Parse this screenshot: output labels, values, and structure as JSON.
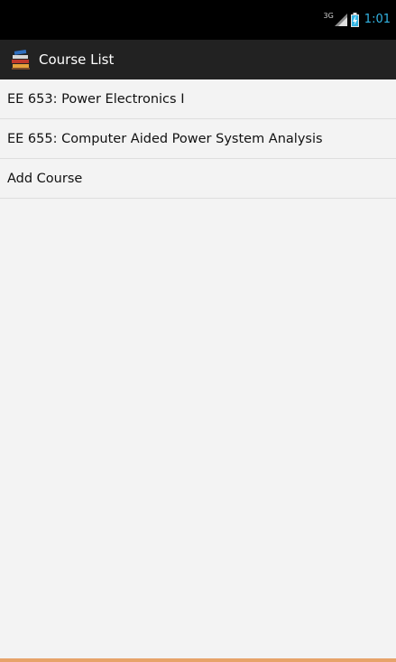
{
  "status_bar": {
    "network_type": "3G",
    "signal_icon": "signal-strength-icon",
    "battery_icon": "battery-charging-icon",
    "time": "1:01",
    "time_color": "#33b5e5"
  },
  "action_bar": {
    "icon": "books-app-icon",
    "title": "Course List"
  },
  "courses": [
    {
      "label": "EE 653: Power Electronics I"
    },
    {
      "label": "EE 655: Computer Aided Power System Analysis"
    },
    {
      "label": "Add Course"
    }
  ],
  "colors": {
    "status_bar_bg": "#000000",
    "action_bar_bg": "#222222",
    "content_bg": "#f3f3f3",
    "bottom_accent": "#e7a36a"
  }
}
